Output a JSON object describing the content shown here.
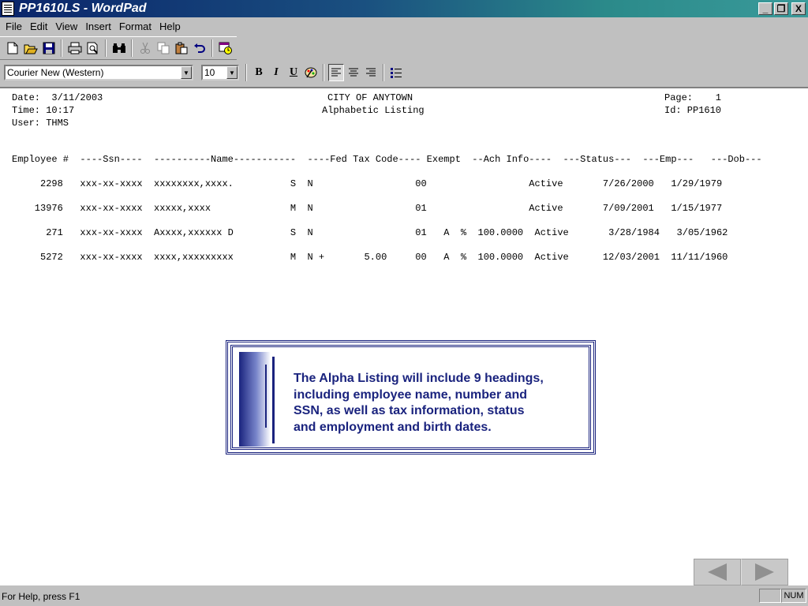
{
  "window": {
    "title": "PP1610LS - WordPad",
    "buttons": {
      "minimize": "_",
      "restore": "❐",
      "close": "X"
    }
  },
  "menu": {
    "items": [
      {
        "label": "File"
      },
      {
        "label": "Edit"
      },
      {
        "label": "View"
      },
      {
        "label": "Insert"
      },
      {
        "label": "Format"
      },
      {
        "label": "Help"
      }
    ]
  },
  "toolbar": {
    "icons": [
      "new-icon",
      "open-icon",
      "save-icon",
      "print-icon",
      "print-preview-icon",
      "find-icon",
      "cut-icon",
      "copy-icon",
      "paste-icon",
      "undo-icon",
      "insert-datetime-icon"
    ]
  },
  "formatbar": {
    "font": "Courier New (Western)",
    "size": "10",
    "bold": "B",
    "italic": "I",
    "underline": "U"
  },
  "report": {
    "header_left": [
      "Date:  3/11/2003",
      "Time: 10:17",
      "User: THMS"
    ],
    "header_center": [
      "CITY OF ANYTOWN",
      "Alphabetic Listing"
    ],
    "header_right": [
      "Page:    1",
      "Id: PP1610"
    ],
    "columns": "Employee #  ----Ssn----  ----------Name-----------  ----Fed Tax Code---- Exempt  --Ach Info----  ---Status---  ---Emp---   ---Dob---",
    "rows": [
      "     2298   xxx-xx-xxxx  xxxxxxxx,xxxx.          S  N                  00                  Active       7/26/2000   1/29/1979",
      "    13976   xxx-xx-xxxx  xxxxx,xxxx              M  N                  01                  Active       7/09/2001   1/15/1977",
      "      271   xxx-xx-xxxx  Axxxx,xxxxxx D          S  N                  01   A  %  100.0000  Active       3/28/1984   3/05/1962",
      "     5272   xxx-xx-xxxx  xxxx,xxxxxxxxx          M  N +       5.00     00   A  %  100.0000  Active      12/03/2001  11/11/1960"
    ]
  },
  "callout": {
    "lines": [
      "The Alpha Listing will include 9 headings,",
      "including employee name, number and",
      "SSN, as well as tax information, status",
      "and employment and birth dates."
    ]
  },
  "status": {
    "help": "For Help, press F1",
    "num": "NUM"
  }
}
